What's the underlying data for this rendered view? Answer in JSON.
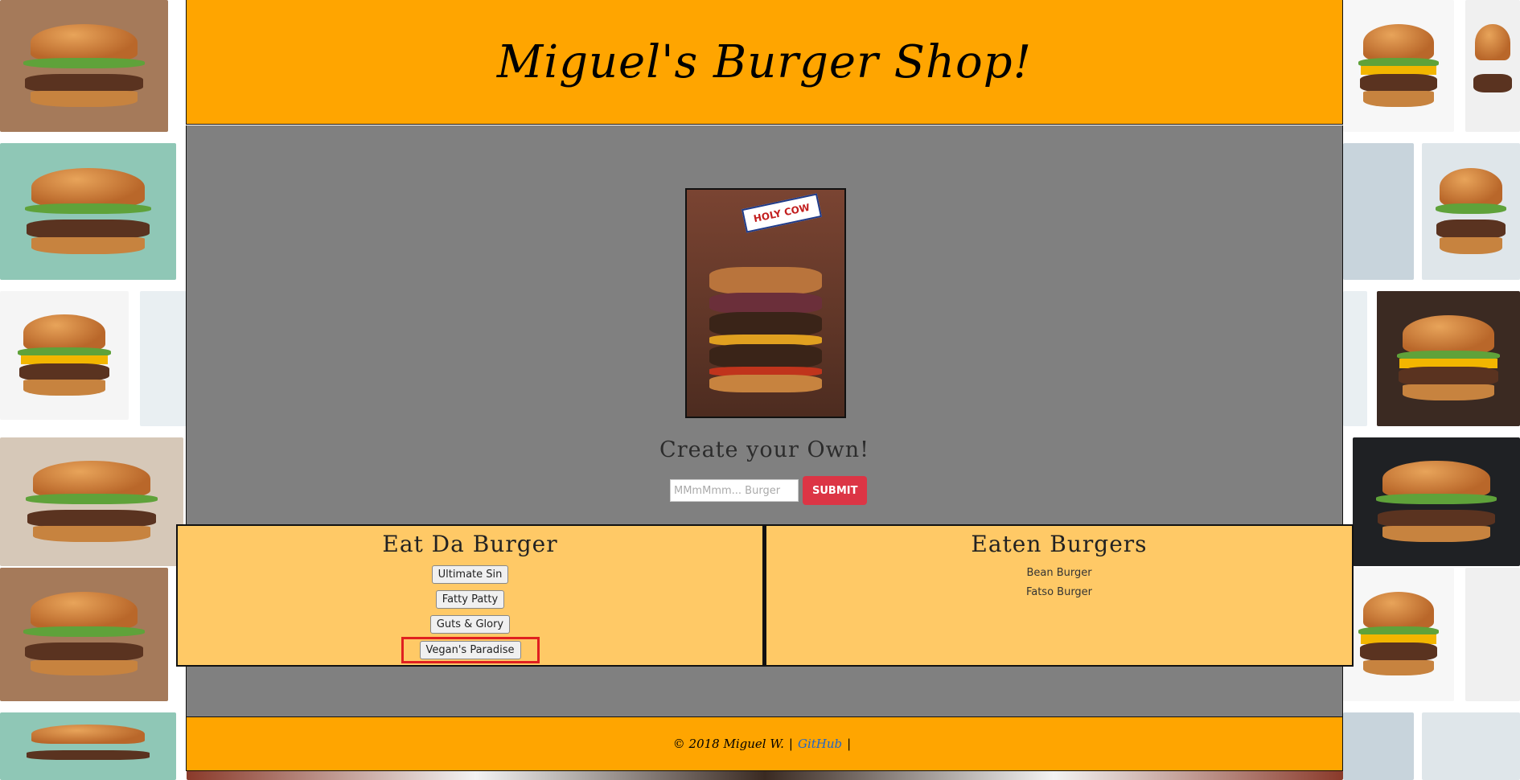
{
  "header": {
    "title": "Miguel's Burger Shop!"
  },
  "hero": {
    "flag_text": "HOLY COW"
  },
  "create": {
    "title": "Create your Own!",
    "placeholder": "MMmMmm... Burger",
    "submit_label": "SUBMIT"
  },
  "eat_panel": {
    "title": "Eat Da Burger",
    "burgers": [
      "Ultimate Sin",
      "Fatty Patty",
      "Guts & Glory",
      "Vegan's Paradise"
    ]
  },
  "eaten_panel": {
    "title": "Eaten Burgers",
    "burgers": [
      "Bean Burger",
      "Fatso Burger"
    ]
  },
  "footer": {
    "copyright": "© 2018 Miguel W.",
    "separator": "|",
    "github_label": "GitHub"
  },
  "colors": {
    "header_bg": "#ffa500",
    "main_bg": "#808080",
    "panel_bg": "#ffc966",
    "submit_bg": "#dc3545",
    "highlight": "#e02020",
    "link": "#1e66c8"
  }
}
